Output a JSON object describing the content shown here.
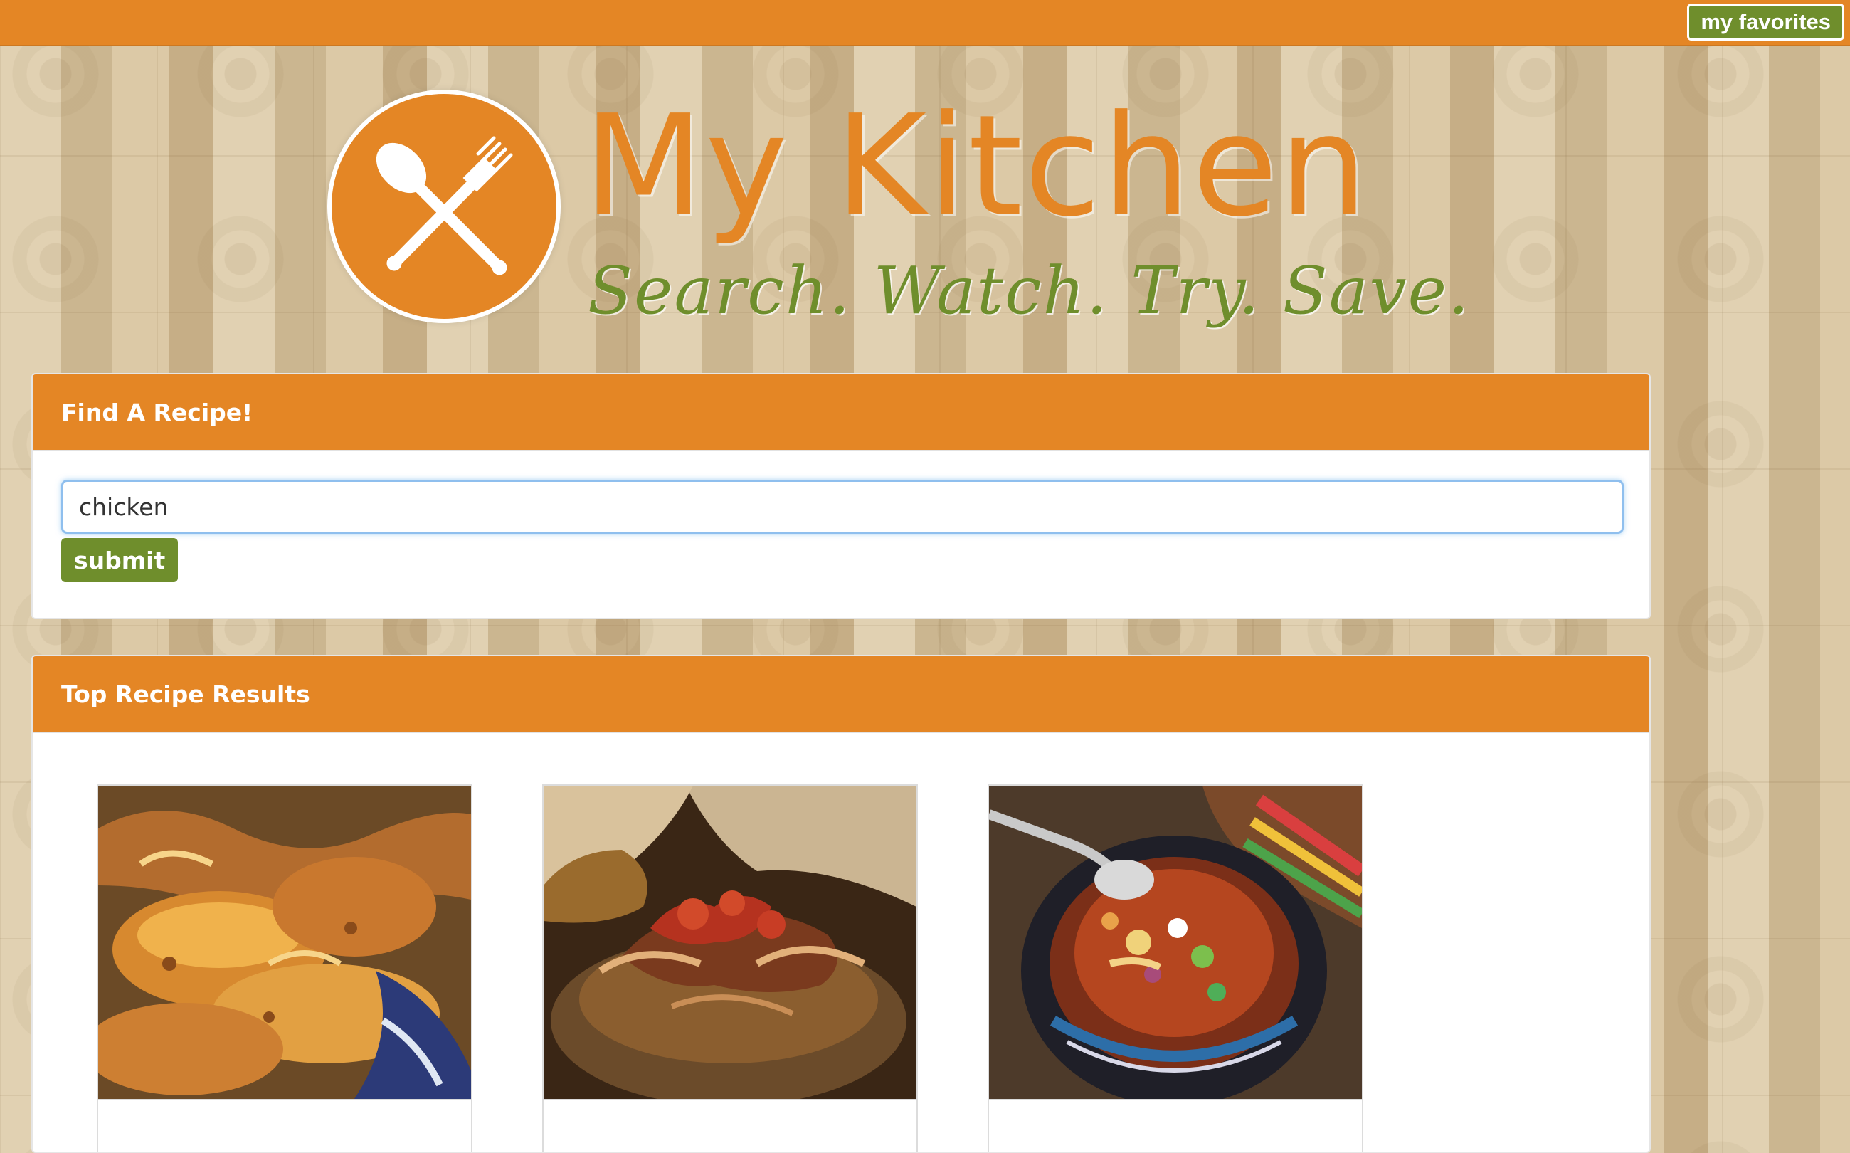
{
  "top_bar": {
    "favorites_label": "my favorites"
  },
  "brand": {
    "title": "My Kitchen",
    "tagline": "Search. Watch. Try. Save."
  },
  "search_panel": {
    "header": "Find A Recipe!",
    "input_value": "chicken",
    "submit_label": "submit"
  },
  "results_panel": {
    "header": "Top Recipe Results",
    "cards": [
      {
        "image": "roasted-chicken-image"
      },
      {
        "image": "tomato-chicken-image"
      },
      {
        "image": "chicken-tortilla-soup-image"
      }
    ]
  },
  "colors": {
    "primary_orange": "#e48625",
    "accent_green": "#6f8e2c",
    "white": "#ffffff",
    "focus_blue": "#8fbfee"
  }
}
